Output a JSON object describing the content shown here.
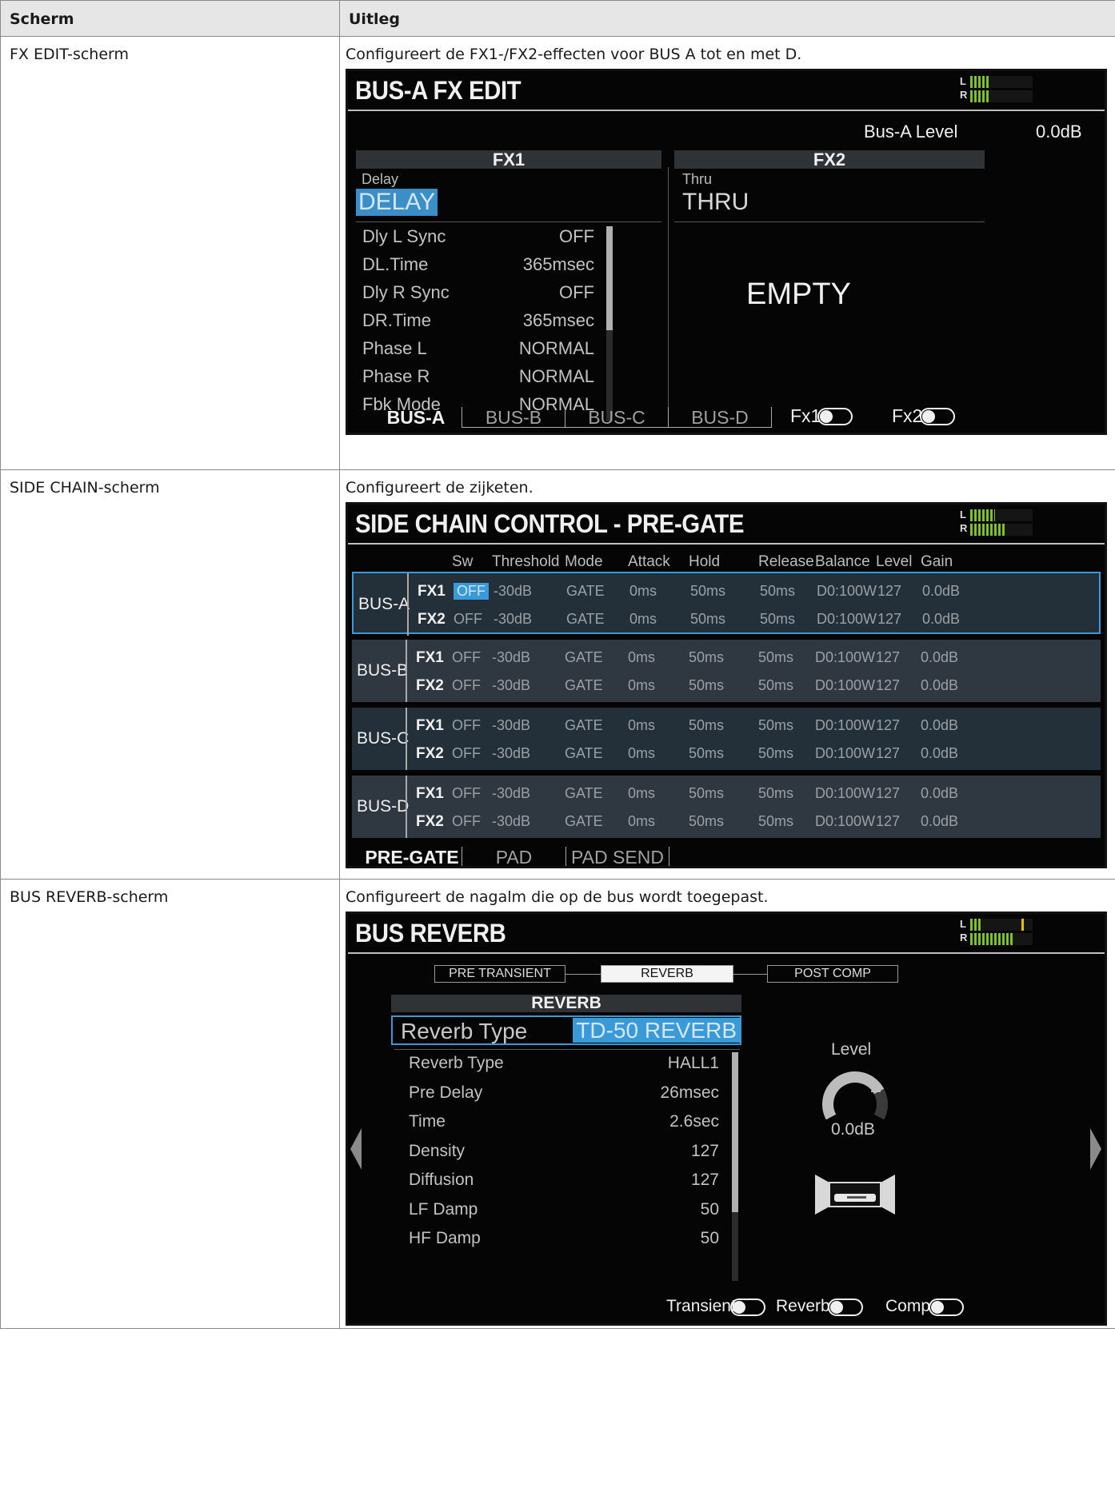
{
  "table": {
    "col1_header": "Scherm",
    "col2_header": "Uitleg"
  },
  "rows": [
    {
      "name": "FX EDIT-scherm",
      "description": "Configureert de FX1-/FX2-effecten voor BUS A tot en met D."
    },
    {
      "name": "SIDE CHAIN-scherm",
      "description": "Configureert de zijketen."
    },
    {
      "name": "BUS REVERB-scherm",
      "description": "Configureert de nagalm die op de bus wordt toegepast."
    }
  ],
  "meter_labels": {
    "left": "L",
    "right": "R"
  },
  "fx_edit": {
    "title": "BUS-A FX EDIT",
    "level_label": "Bus-A Level",
    "level_value": "0.0dB",
    "fx1": {
      "band": "FX1",
      "category": "Delay",
      "type": "DELAY",
      "params": [
        {
          "name": "Dly L Sync",
          "value": "OFF"
        },
        {
          "name": "DL.Time",
          "value": "365msec"
        },
        {
          "name": "Dly R Sync",
          "value": "OFF"
        },
        {
          "name": "DR.Time",
          "value": "365msec"
        },
        {
          "name": "Phase L",
          "value": "NORMAL"
        },
        {
          "name": "Phase R",
          "value": "NORMAL"
        },
        {
          "name": "Fbk Mode",
          "value": "NORMAL"
        }
      ]
    },
    "fx2": {
      "band": "FX2",
      "category": "Thru",
      "type": "THRU",
      "empty": "EMPTY"
    },
    "tabs": [
      "BUS-A",
      "BUS-B",
      "BUS-C",
      "BUS-D"
    ],
    "switches": [
      "Fx1",
      "Fx2"
    ],
    "meter": {
      "left_level": 0.3,
      "right_level": 0.3
    }
  },
  "side_chain": {
    "title": "SIDE CHAIN CONTROL - PRE-GATE",
    "headers": [
      "Sw",
      "Threshold",
      "Mode",
      "Attack",
      "Hold",
      "Release",
      "Balance",
      "Level",
      "Gain"
    ],
    "buses": [
      {
        "name": "BUS-A",
        "rows": [
          {
            "fx": "FX1",
            "cells": [
              "OFF",
              "-30dB",
              "GATE",
              "0ms",
              "50ms",
              "50ms",
              "D0:100W",
              "127",
              "0.0dB"
            ]
          },
          {
            "fx": "FX2",
            "cells": [
              "OFF",
              "-30dB",
              "GATE",
              "0ms",
              "50ms",
              "50ms",
              "D0:100W",
              "127",
              "0.0dB"
            ]
          }
        ]
      },
      {
        "name": "BUS-B",
        "rows": [
          {
            "fx": "FX1",
            "cells": [
              "OFF",
              "-30dB",
              "GATE",
              "0ms",
              "50ms",
              "50ms",
              "D0:100W",
              "127",
              "0.0dB"
            ]
          },
          {
            "fx": "FX2",
            "cells": [
              "OFF",
              "-30dB",
              "GATE",
              "0ms",
              "50ms",
              "50ms",
              "D0:100W",
              "127",
              "0.0dB"
            ]
          }
        ]
      },
      {
        "name": "BUS-C",
        "rows": [
          {
            "fx": "FX1",
            "cells": [
              "OFF",
              "-30dB",
              "GATE",
              "0ms",
              "50ms",
              "50ms",
              "D0:100W",
              "127",
              "0.0dB"
            ]
          },
          {
            "fx": "FX2",
            "cells": [
              "OFF",
              "-30dB",
              "GATE",
              "0ms",
              "50ms",
              "50ms",
              "D0:100W",
              "127",
              "0.0dB"
            ]
          }
        ]
      },
      {
        "name": "BUS-D",
        "rows": [
          {
            "fx": "FX1",
            "cells": [
              "OFF",
              "-30dB",
              "GATE",
              "0ms",
              "50ms",
              "50ms",
              "D0:100W",
              "127",
              "0.0dB"
            ]
          },
          {
            "fx": "FX2",
            "cells": [
              "OFF",
              "-30dB",
              "GATE",
              "0ms",
              "50ms",
              "50ms",
              "D0:100W",
              "127",
              "0.0dB"
            ]
          }
        ]
      }
    ],
    "tabs": [
      "PRE-GATE",
      "PAD ASSIGN",
      "PAD SEND"
    ],
    "meter": {
      "left_level": 0.4,
      "right_level": 0.55
    }
  },
  "bus_reverb": {
    "title": "BUS REVERB",
    "steps": [
      "PRE TRANSIENT",
      "REVERB",
      "POST COMP"
    ],
    "band": "REVERB",
    "type_label": "Reverb Type",
    "type_value": "TD-50 REVERB",
    "params": [
      {
        "name": "Reverb Type",
        "value": "HALL1"
      },
      {
        "name": "Pre Delay",
        "value": "26msec"
      },
      {
        "name": "Time",
        "value": "2.6sec"
      },
      {
        "name": "Density",
        "value": "127"
      },
      {
        "name": "Diffusion",
        "value": "127"
      },
      {
        "name": "LF Damp",
        "value": "50"
      },
      {
        "name": "HF Damp",
        "value": "50"
      }
    ],
    "level_label": "Level",
    "level_value": "0.0dB",
    "switches": [
      "Transient",
      "Reverb",
      "Comp"
    ],
    "meter": {
      "left_level": 0.18,
      "right_level": 0.68,
      "left_peak": 0.82
    }
  },
  "colors": {
    "accent": "#3a9ad8",
    "lcd_background": "#050505",
    "meter_green": "#7ec12e",
    "meter_peak": "#e8c000"
  }
}
